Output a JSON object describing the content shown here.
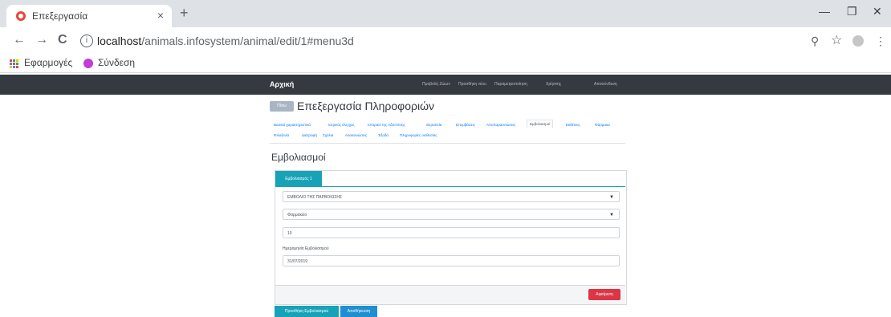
{
  "browser": {
    "tab_title": "Επεξεργασία",
    "tab_close": "×",
    "new_tab": "+",
    "url_host": "localhost",
    "url_path": "/animals.infosystem/animal/edit/1#menu3d",
    "back": "←",
    "forward": "→",
    "reload": "C",
    "info": "i",
    "zoom": "⚲",
    "star": "☆",
    "menu": "⋮",
    "minimize": "—",
    "restore": "❐",
    "close": "✕"
  },
  "bookmarks": {
    "apps_label": "Εφαρμογές",
    "login_label": "Σύνδεση"
  },
  "navbar": {
    "brand": "Αρχική",
    "links": [
      "Προβολή Ζώων",
      "Προσθήκη νέου",
      "Παραμετροποίηση",
      "Χρήστης",
      "Αποσύνδεση"
    ]
  },
  "page": {
    "back_label": "Πίσω",
    "title": "Επεξεργασία Πληροφοριών",
    "tabs": [
      "Βασικά χαρακτηριστικά",
      "Ιατρικός έλεγχος",
      "Ιστορικό της Αδοπτ/σης",
      "Θεραπεία",
      "Επεμβάσεις",
      "Αποπαρασιτώσεις",
      "Εμβολιασμοί",
      "Εκθέσεις",
      "Φάρμακα",
      "Φιλοξενία",
      "Διατροφή",
      "Σχόλια",
      "Ανακοινώσεις",
      "Έξοδα",
      "Πληροφορίες υιοθεσίας"
    ],
    "active_tab": "Εμβολιασμοί",
    "section_title": "Εμβολιασμοί",
    "card_tab": "Εμβολιασμός 1",
    "vaccine_select": "ΕΜΒΟΛΙΟ ΤΗΣ ΠΑΡΒΟΙΩΣΗΣ",
    "vet_select": "Φαρμακείο",
    "dose_value": "10",
    "date_label": "Ημερομηνία Εμβολιασμού",
    "date_value": "31/07/2019",
    "remove_button": "Αφαίρεση",
    "add_button": "Προσθήκη Εμβολιασμού",
    "save_button": "Αποθήκευση"
  }
}
